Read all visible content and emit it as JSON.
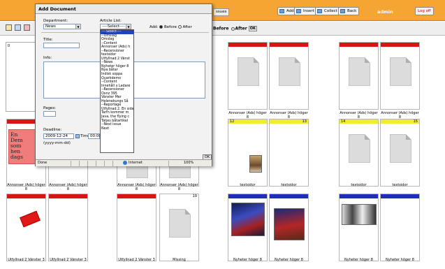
{
  "app": {
    "toolbar_buttons": [
      {
        "label": "Add",
        "icon": "add-icon"
      },
      {
        "label": "Insert",
        "icon": "insert-icon"
      },
      {
        "label": "Collect",
        "icon": "collect-icon"
      },
      {
        "label": "Back",
        "icon": "back-icon"
      }
    ],
    "partial_button": "ssues",
    "user": "admin",
    "logoff": "Log off",
    "position": {
      "before": "Before",
      "after": "After",
      "ok": "OK"
    }
  },
  "pages": {
    "row1": [
      {
        "caption": "Annonser (Ads) höger 8"
      },
      {
        "caption": "Annonser (Ads) höger 8"
      },
      {
        "caption": "Annonser (Ads) höger 8"
      },
      {
        "caption": "Annonser (Ads) höger 8"
      }
    ],
    "row2": [
      {
        "caption": "Annonser (Ads) höger 8"
      },
      {
        "caption": "Annonser (Ads) höger 8"
      },
      {
        "caption": "Annonser (Ads) höger 8"
      },
      {
        "caption": "Annonser (Ads) höger 8"
      },
      {
        "caption": "textsidor",
        "num": "12"
      },
      {
        "caption": "textsidor",
        "num": "13"
      },
      {
        "caption": "textsidor",
        "num": "14"
      },
      {
        "caption": "textsidor",
        "num": "15"
      }
    ],
    "row3": [
      {
        "caption": "Utfyllnad 2 Vänster 3"
      },
      {
        "caption": "Utfyllnad 2 Vänster 3"
      },
      {
        "caption": "Utfyllnad 2 Vänster 3"
      },
      {
        "caption": "Missing",
        "num": "19"
      },
      {
        "caption": "Nyheter höger 8"
      },
      {
        "caption": "Nyheter höger 8"
      },
      {
        "caption": "Nyheter höger 8"
      },
      {
        "caption": "Nyheter höger 8"
      }
    ],
    "ad_text": "En Dem som hen dags",
    "left_panel_num": "0"
  },
  "dialog": {
    "title": "Add Document",
    "department_label": "Department:",
    "department_value": "News",
    "article_list_label": "Article List:",
    "article_list_value": "----Select----",
    "add_label": "Add:",
    "before": "Before",
    "after": "After",
    "title_label": "Title:",
    "info_label": "Info:",
    "pages_label": "Pages:",
    "deadline_label": "Deadline:",
    "deadline_value": "2009-12-24",
    "time_label": "Time:",
    "time_value": "00:00",
    "date_format": "(yyyy-mm-dd)",
    "ok": "OK",
    "article_options": [
      "----Select----",
      "--Omslag",
      "Omslag",
      "--Content",
      "Annonser (Ads) h",
      "--Recensioner",
      "textsidor",
      "Utfyllnad 2 Vänst",
      "--News",
      "Nyheter höger 8",
      "Nya båtar",
      "Indisk soppa",
      "Quarkdemo",
      "--Content",
      "Innehåll x Ledare",
      "--Recensioner",
      "Oxnz 395",
      "Vänster Mer",
      "Helenekungs Så",
      "--Reportage",
      "Utfyllnad 2. En side",
      "Tarfn kommer m",
      "Java, the flying c",
      "Tatjes båtartikel",
      "--Next issue",
      "Next"
    ],
    "status": {
      "left": "Done",
      "zone": "Internet",
      "zoom": "100%"
    }
  },
  "colors": {
    "topbar": "#f4a532",
    "section_red": "#d81515",
    "section_yellow": "#f0ed2f",
    "section_blue": "#1b2fb8",
    "list_highlight": "#1e46b9"
  }
}
